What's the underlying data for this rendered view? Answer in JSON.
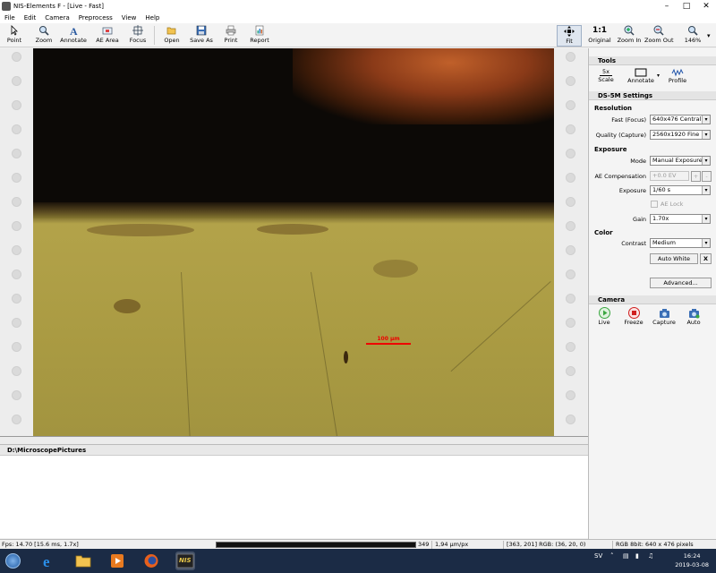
{
  "window": {
    "title": "NIS-Elements F - [Live - Fast]"
  },
  "menu": [
    "File",
    "Edit",
    "Camera",
    "Preprocess",
    "View",
    "Help"
  ],
  "toolbar": {
    "point": "Point",
    "zoom": "Zoom",
    "annotate": "Annotate",
    "ae_area": "AE Area",
    "focus": "Focus",
    "open": "Open",
    "save_as": "Save As",
    "print": "Print",
    "report": "Report",
    "fit": "Fit",
    "original_top": "1:1",
    "original": "Original",
    "zoom_in": "Zoom In",
    "zoom_out": "Zoom Out",
    "zoom_level": "146%"
  },
  "image": {
    "scale_bar_label": "100 µm"
  },
  "panel": {
    "tools_title": "Tools",
    "tools": {
      "scale_icon_text": "5x",
      "scale": "Scale",
      "annotate": "Annotate",
      "profile": "Profile"
    },
    "settings_title": "DS-5M Settings",
    "resolution_title": "Resolution",
    "fast_label": "Fast (Focus)",
    "fast_value": "640x476 Central",
    "quality_label": "Quality (Capture)",
    "quality_value": "2560x1920 Fine",
    "exposure_title": "Exposure",
    "mode_label": "Mode",
    "mode_value": "Manual Exposure",
    "ae_comp_label": "AE Compensation",
    "ae_comp_value": "+0.0 EV",
    "ae_plus": "+",
    "ae_minus": "-",
    "exposure_label": "Exposure",
    "exposure_value": "1/60 s",
    "ae_lock": "AE Lock",
    "gain_label": "Gain",
    "gain_value": "1.70x",
    "color_title": "Color",
    "contrast_label": "Contrast",
    "contrast_value": "Medium",
    "auto_white": "Auto White",
    "auto_white_x": "X",
    "advanced": "Advanced...",
    "camera_title": "Camera",
    "camera": {
      "live": "Live",
      "freeze": "Freeze",
      "capture": "Capture",
      "auto": "Auto"
    }
  },
  "path": {
    "title": "D:\\MicroscopePictures"
  },
  "status": {
    "fps": "Fps: 14.70 [15.6 ms, 1.7x]",
    "frame": "349",
    "scale": "1,94 µm/px",
    "pixel": "[363, 201] RGB: (36, 20, 0)",
    "format": "RGB 8bit: 640 x 476 pixels"
  },
  "taskbar": {
    "lang": "SV",
    "time": "16:24",
    "date": "2019-03-08",
    "nis_label": "NIS"
  },
  "colors": {
    "accent": "#3a6ea5",
    "scale_bar": "#e00000",
    "live_green": "#3aa640",
    "freeze_red": "#d02020"
  }
}
